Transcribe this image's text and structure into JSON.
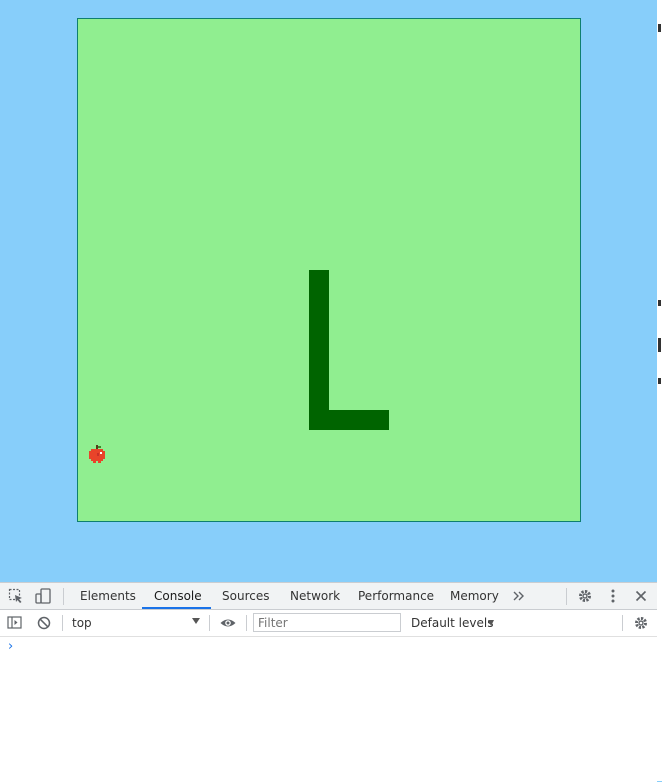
{
  "game": {
    "board_color": "#90ee90",
    "background_color": "#87cefa",
    "snake_color": "#006400",
    "apple_color": "#e8442a",
    "snake_shape": "L",
    "apple_icon": "apple-icon"
  },
  "devtools": {
    "tabs": [
      {
        "label": "Elements"
      },
      {
        "label": "Console"
      },
      {
        "label": "Sources"
      },
      {
        "label": "Network"
      },
      {
        "label": "Performance"
      },
      {
        "label": "Memory"
      }
    ],
    "active_tab": "Console",
    "accent_color": "#1a73e8",
    "context_value": "top",
    "filter_placeholder": "Filter",
    "levels_label": "Default levels",
    "prompt_symbol": "›"
  }
}
